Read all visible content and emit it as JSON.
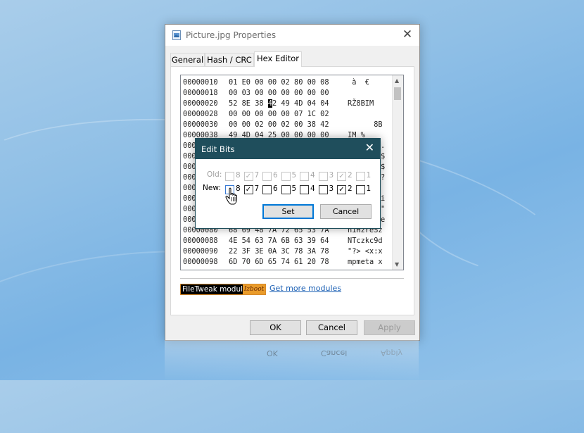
{
  "window": {
    "title": "Picture.jpg Properties",
    "close_glyph": "✕",
    "tabs": [
      {
        "label": "General",
        "active": false
      },
      {
        "label": "Hash / CRC",
        "active": false
      },
      {
        "label": "Hex Editor",
        "active": true
      }
    ]
  },
  "hex": {
    "rows": [
      {
        "offset": "00000010",
        "bytes": "01 E0 00 00 02 80 00 08",
        "ascii": " à  €"
      },
      {
        "offset": "00000018",
        "bytes": "00 03 00 00 00 00 00 00",
        "ascii": ""
      },
      {
        "offset": "00000020",
        "bytes_before": "52 8E 38 ",
        "cursor": "4",
        "bytes_after": "2 49 4D 04 04",
        "ascii": "RŽ8BIM"
      },
      {
        "offset": "00000028",
        "bytes": "00 00 00 00 00 07 1C 02",
        "ascii": ""
      },
      {
        "offset": "00000030",
        "bytes": "00 00 02 00 02 00 38 42",
        "ascii": "      8B"
      },
      {
        "offset": "00000038",
        "bytes": "49 4D 04 25 00 00 00 00",
        "ascii": "IM %"
      },
      {
        "offset": "00000040",
        "bytes": "",
        "ascii": ""
      },
      {
        "offset": "00000048",
        "bytes": "",
        "ascii": ""
      },
      {
        "offset": "00000050",
        "bytes": "",
        "ascii": ""
      },
      {
        "offset": "00000058",
        "bytes": "",
        "ascii": ""
      },
      {
        "offset": "00000060",
        "bytes": "",
        "ascii": ""
      },
      {
        "offset": "00000068",
        "bytes": "",
        "ascii": ""
      },
      {
        "offset": "00000070",
        "bytes": "",
        "ascii": ""
      },
      {
        "offset": "00000078",
        "bytes": "",
        "ascii": ""
      },
      {
        "offset": "00000080",
        "bytes": "68 69 48 7A 72 65 53 7A",
        "ascii": "hiHzreSz"
      },
      {
        "offset": "00000088",
        "bytes": "4E 54 63 7A 6B 63 39 64",
        "ascii": "NTczkc9d"
      },
      {
        "offset": "00000090",
        "bytes": "22 3F 3E 0A 3C 78 3A 78",
        "ascii": "\"?> <x:x"
      },
      {
        "offset": "00000098",
        "bytes": "6D 70 6D 65 74 61 20 78",
        "ascii": "mpmeta x"
      }
    ],
    "hidden_right_glyphs": [
      ".",
      "$",
      "$",
      "?",
      "i",
      "\"",
      "e"
    ]
  },
  "module": {
    "badge_text": "FileTweak module",
    "brand": "Izboot",
    "link": "Get more modules"
  },
  "buttons": {
    "ok": "OK",
    "cancel": "Cancel",
    "apply": "Apply"
  },
  "dialog": {
    "title": "Edit Bits",
    "close_glyph": "✕",
    "old_label": "Old:",
    "new_label": "New:",
    "old_bits": [
      {
        "bit": "8",
        "checked": false
      },
      {
        "bit": "7",
        "checked": true
      },
      {
        "bit": "6",
        "checked": false
      },
      {
        "bit": "5",
        "checked": false
      },
      {
        "bit": "4",
        "checked": false
      },
      {
        "bit": "3",
        "checked": false
      },
      {
        "bit": "2",
        "checked": true
      },
      {
        "bit": "1",
        "checked": false
      }
    ],
    "new_bits": [
      {
        "bit": "8",
        "checked": false
      },
      {
        "bit": "7",
        "checked": true
      },
      {
        "bit": "6",
        "checked": false
      },
      {
        "bit": "5",
        "checked": false
      },
      {
        "bit": "4",
        "checked": false
      },
      {
        "bit": "3",
        "checked": false
      },
      {
        "bit": "2",
        "checked": true
      },
      {
        "bit": "1",
        "checked": false
      }
    ],
    "set_label": "Set",
    "cancel_label": "Cancel"
  },
  "colors": {
    "dialog_titlebar": "#1f4e5c",
    "link": "#1a5fb4",
    "brand_orange": "#e99b2a"
  }
}
